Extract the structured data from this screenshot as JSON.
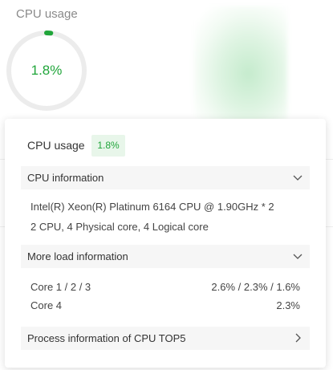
{
  "background": {
    "title": "CPU usage",
    "gauge_value": "1.8%",
    "gauge_fraction": 0.018,
    "accent_color": "#20a53a",
    "track_color": "#ececec"
  },
  "popover": {
    "title": "CPU usage",
    "badge": "1.8%",
    "cpu_info": {
      "header": "CPU information",
      "lines": [
        "Intel(R) Xeon(R) Platinum 6164 CPU @ 1.90GHz * 2",
        "2 CPU, 4 Physical core, 4 Logical core"
      ],
      "icon": "chevron-down-icon"
    },
    "load_info": {
      "header": "More load information",
      "rows": [
        {
          "label": "Core 1 / 2 / 3",
          "value": "2.6% / 2.3% / 1.6%"
        },
        {
          "label": "Core 4",
          "value": "2.3%"
        }
      ],
      "icon": "chevron-down-icon"
    },
    "process_info": {
      "header": "Process information of CPU TOP5",
      "icon": "chevron-right-icon"
    }
  }
}
